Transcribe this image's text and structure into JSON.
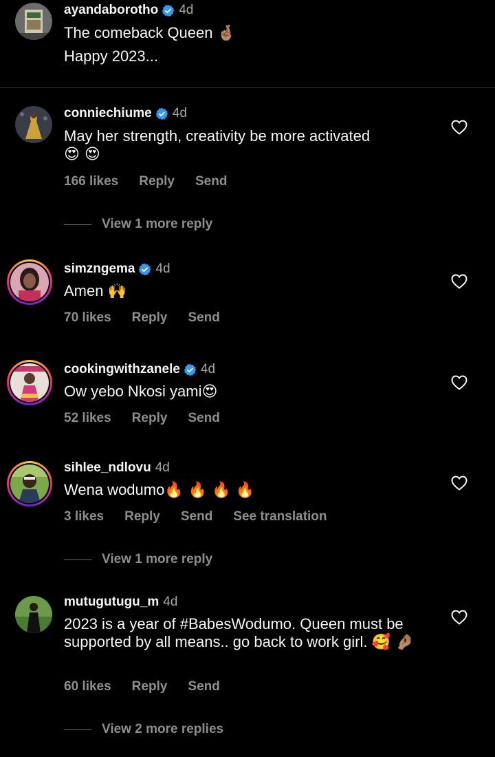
{
  "caption": {
    "username": "ayandaborotho",
    "time": "4d",
    "line1": "The comeback Queen",
    "line1_emoji": "🤞🏽",
    "line2": "Happy 2023..."
  },
  "comments": [
    {
      "username": "conniechiume",
      "verified": true,
      "time": "4d",
      "text": "May her strength, creativity be more activated",
      "emoji": "😍 😍",
      "likes": "166 likes",
      "reply": "Reply",
      "send": "Send",
      "view_more": "View 1 more reply"
    },
    {
      "username": "simzngema",
      "verified": true,
      "time": "4d",
      "text": "Amen",
      "emoji": "🙌",
      "likes": "70 likes",
      "reply": "Reply",
      "send": "Send"
    },
    {
      "username": "cookingwithzanele",
      "verified": true,
      "time": "4d",
      "text": "Ow yebo Nkosi yami",
      "emoji": "😍",
      "likes": "52 likes",
      "reply": "Reply",
      "send": "Send"
    },
    {
      "username": "sihlee_ndlovu",
      "verified": false,
      "time": "4d",
      "text": "Wena wodumo",
      "emoji": "🔥 🔥 🔥 🔥",
      "likes": "3 likes",
      "reply": "Reply",
      "send": "Send",
      "translate": "See translation",
      "view_more": "View 1 more reply"
    },
    {
      "username": "mutugutugu_m",
      "verified": false,
      "time": "4d",
      "text": "2023  is a year of #BabesWodumo. Queen must be supported by all means.. go back to work girl.",
      "emoji": "🥰 🤌🏽",
      "likes": "60 likes",
      "reply": "Reply",
      "send": "Send",
      "view_more": "View 2 more replies"
    }
  ],
  "icons": {
    "verified": "verified-badge-icon",
    "like": "heart-outline-icon"
  },
  "colors": {
    "background": "#000000",
    "text": "#f5f5f5",
    "muted": "#8e8e8e",
    "verified": "#3897f0"
  }
}
